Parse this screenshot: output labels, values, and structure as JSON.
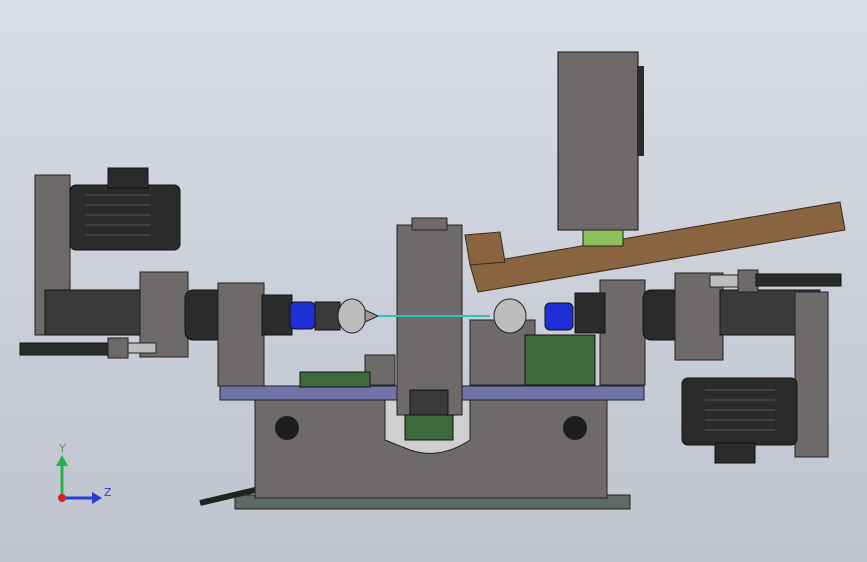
{
  "viewport": {
    "background_top": "#d9dde5",
    "background_bottom": "#bfc4ce"
  },
  "model": {
    "frame_color": "#6e6a6a",
    "dark_part_color": "#2b2b2b",
    "table_top_color": "#6f73a8",
    "chuck_color": "#1f2fd6",
    "wood_color": "#8a6440",
    "green_part_color": "#3c6a3c"
  },
  "triad": {
    "y_label": "Y",
    "z_label": "Z",
    "y_color": "#2ab04a",
    "z_color": "#2a3bd6",
    "origin_color": "#d6202a"
  }
}
